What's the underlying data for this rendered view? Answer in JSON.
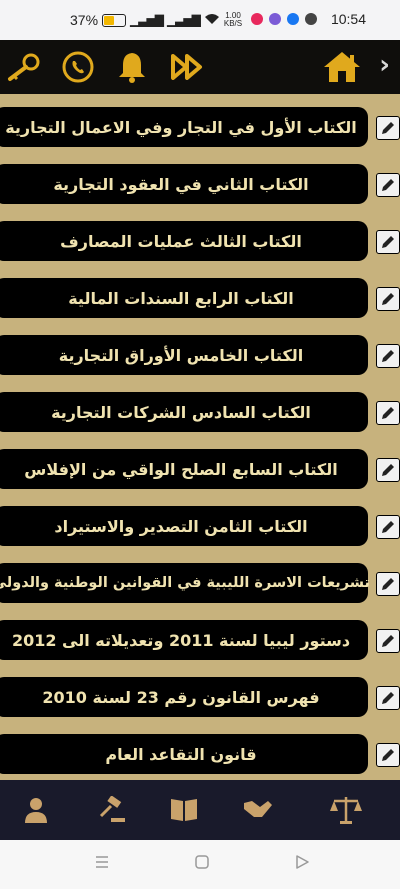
{
  "status_bar": {
    "battery": "37%",
    "network_speed": "1.00",
    "network_unit": "KB/S",
    "time": "10:54"
  },
  "toolbar": {
    "icons": [
      "key-search-icon",
      "whatsapp-icon",
      "bell-icon",
      "fast-forward-icon",
      "home-icon",
      "chevron-right-icon"
    ]
  },
  "items": [
    {
      "label": "الكتاب الأول في التجار وفي الاعمال التجارية"
    },
    {
      "label": "الكتاب الثاني في العقود التجارية"
    },
    {
      "label": "الكتاب الثالث عمليات المصارف"
    },
    {
      "label": "الكتاب الرابع السندات المالية"
    },
    {
      "label": "الكتاب الخامس الأوراق التجارية"
    },
    {
      "label": "الكتاب السادس الشركات التجارية"
    },
    {
      "label": "الكتاب السابع الصلح الواقي من الإفلاس"
    },
    {
      "label": "الكتاب الثامن التصدير والاستيراد"
    },
    {
      "label": "تشريعات الاسرة الليبية في القوانين الوطنية والدولي"
    },
    {
      "label": "دستور ليبيا لسنة 2011 وتعديلاته الى 2012"
    },
    {
      "label": "فهرس القانون رقم 23 لسنة 2010"
    },
    {
      "label": "قانون التقاعد العام"
    }
  ],
  "bottom_nav": {
    "icons": [
      "person-icon",
      "gavel-icon",
      "book-icon",
      "handshake-icon",
      "scales-icon"
    ]
  },
  "colors": {
    "background": "#c7b27d",
    "bar": "#0f0e0c",
    "pill": "#000000",
    "pill_text": "#f0e3b0",
    "gold": "#e0a91d",
    "bottom_nav": "#191a2b"
  }
}
